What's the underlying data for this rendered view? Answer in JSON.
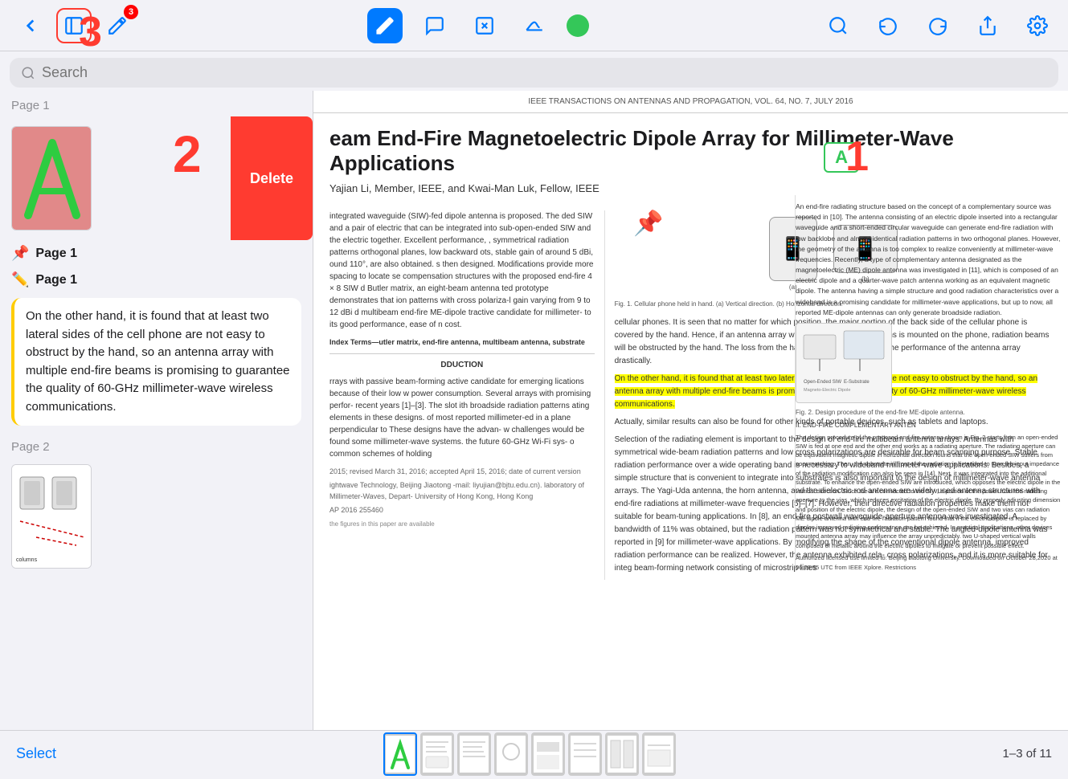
{
  "toolbar": {
    "back_label": "‹",
    "sidebar_icon": "sidebar-icon",
    "pen_icon": "pen-icon",
    "markup_icon": "markup-icon",
    "lasso_icon": "lasso-icon",
    "shape_icon": "shape-icon",
    "signature_icon": "signature-icon",
    "color_dot": "green-dot",
    "search_icon": "search-icon",
    "undo_icon": "undo-icon",
    "redo_icon": "redo-icon",
    "share_icon": "share-icon",
    "settings_icon": "settings-icon",
    "badge_number": "3"
  },
  "search": {
    "placeholder": "Search"
  },
  "sidebar": {
    "page1_label": "Page 1",
    "page1_annotation1_icon": "📌",
    "page1_annotation1_label": "Page 1",
    "page1_annotation2_icon": "✏️",
    "page1_annotation2_label": "Page 1",
    "annotation_text": "On the other hand, it is found that at least two lateral sides of the cell phone are not easy to obstruct by the hand, so an antenna array with multiple end-fire beams is promising to guarantee the quality of 60-GHz millimeter-wave wireless communications.",
    "page2_label": "Page 2",
    "delete_label": "Delete"
  },
  "pdf": {
    "journal_header": "IEEE TRANSACTIONS ON ANTENNAS AND PROPAGATION, VOL. 64, NO. 7, JULY 2016",
    "title": "eam End-Fire Magnetoelectric Dipole Array for Millimeter-Wave Applications",
    "authors": "Yajian Li, Member, IEEE, and Kwai-Man Luk, Fellow, IEEE",
    "col_left_text": "integrated waveguide (SIW)-fed dipole antenna is proposed. The ded SIW and a pair of electric that can be integrated into sub-open-ended SIW and the electric together. Excellent performance, , symmetrical radiation patterns orthogonal planes, low backward ots, stable gain of around 5 dBi, ound 110°, are also obtained. s then designed. Modifications provide more spacing to locate se compensation structures with the proposed end-fire 4 × 8 SIW d Butler matrix, an eight-beam antenna ted prototype demonstrates that ion patterns with cross polariza-l gain varying from 9 to 12 dBi d multibeam end-fire ME-dipole tractive candidate for millimeter- to its good performance, ease of n cost.",
    "keywords": "utler matrix, end-fire antenna, multibeam antenna, substrate",
    "section_intro": "DDUCTION",
    "body_text": "rrays with passive beam-forming active candidate for emerging lications because of their low w power consumption. Several arrays with promising perfor- recent years [1]–[3]. The slot ith broadside radiation patterns ating elements in these designs. of most reported millimeter-ed in a plane perpendicular to These designs have the advan- w challenges would be found some millimeter-wave systems. the future 60-GHz Wi-Fi sys- o common schemes of holding",
    "col_right_text1": "cellular phones. It is seen that no matter for which position, the major portion of the back side of the cellular phone is covered by the hand. Hence, if an antenna array with multiple broadside beams is mounted on the phone, radiation beams will be obstructed by the hand. The loss from the hand tissue would degrade the performance of the antenna array drastically.",
    "highlight_text": "On the other hand, it is found that at least two lateral sides of the cell phone are not easy to obstruct by the hand, so an antenna array with multiple end-fire beams is promising to guarantee the quality of 60-GHz millimeter-wave wireless communications.",
    "col_right_text2": "Actually, similar results can also be found for other kinds of portable devices, such as tablets and laptops.",
    "col_right_text3": "Selection of the radiating element is important to the design of end-fire multibeam antenna arrays. Antennas with symmetrical wide-beam radiation patterns and low cross polarizations are desirable for beam scanning purpose. Stable radiation performance over a wide operating band is necessary to wideband millimeter-wave applications. Besides, a simple structure that is convenient to integrate into substrates is also important to the design of millimeter-wave antenna arrays. The Yagi-Uda antenna, the horn antenna, and the dielectric rod antenna are widely used antenna structures with end-fire radiations at millimeter-wave frequencies [5]–[7]. However, their directive radiation properties make them not suitable for beam-tuning applications. In [8], an end-fire postwall waveguide-aperture antenna was investigated. A bandwidth of 11% was obtained, but the radiation pattern was not symmetrical and stable. The angled-dipole antenna was reported in [9] for millimeter-wave applications. By modifying the shape of the conventional dipole antenna, improved radiation performance can be realized. However, the antenna exhibited rela- cross polarizations, and it is more suitable for integ beam-forming network consisting of microstrip lines",
    "right_col_academic": "An end-fire radiating structure based on the concept of a complementary source was reported in [10]. The antenna consisting of an electric dipole inserted into a rectangular waveguide and a short-ended circular waveguide can generate end-fire radiation with low backlobe and almost identical radiation patterns in two orthogonal planes. However, the geometry of the antenna is too complex to realize conveniently at millimeter-wave frequencies. Recently, a type of complementary antenna designated as the magnetoelectric (ME) dipole antenna was investigated in [11], which is composed of an electric dipole and a quarter-wave patch antenna working as an equivalent magnetic dipole. The antenna having a simple structure and good radiation characteristics over a wideband is a promising candidate for millimeter-wave applications, but up to now, all reported ME-dipole antennas can only generate broadside radiation.",
    "figure_caption": "Fig. 1. Cellular phone held in hand. (a) Vertical direction. (b) Horizontal direction.",
    "page_counter": "1–3 of 11",
    "date_text": "2015; revised March 31, 2016; accepted April 15, 2016; date of current version",
    "affiliation": "ightwave Technology, Beijing Jiaotong -mail: liyujian@bjtu.edu.cn). laboratory of Millimeter-Waves, Depart- University of Hong Kong, Hong Kong",
    "copyright": "Authorized licensed use limited to: Beijing Jiaotong University. Downloaded on October 28,2020 at 06:29:55 UTC from IEEE Xplore. Restrictions",
    "ap_number": "AP 2016 255460"
  },
  "bottom": {
    "select_label": "Select",
    "page_counter": "1–3 of 11"
  }
}
